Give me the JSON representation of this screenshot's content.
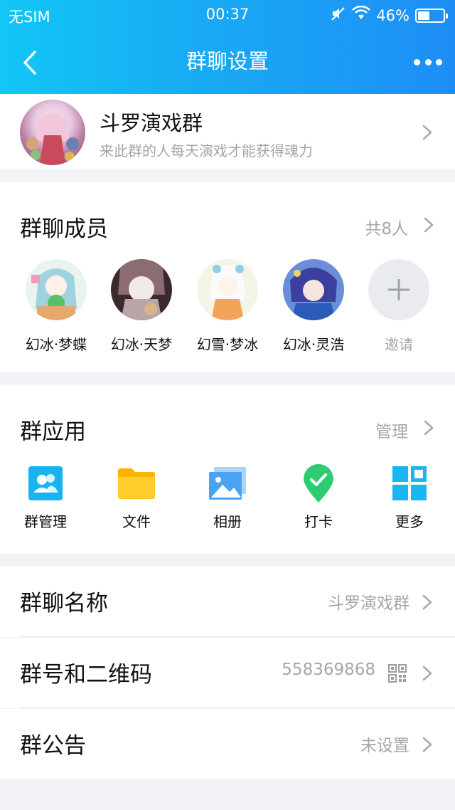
{
  "status_bar": {
    "carrier": "无SIM",
    "time": "00:37",
    "battery": "46%",
    "battery_level": 0.46
  },
  "nav": {
    "title": "群聊设置",
    "back_icon": "chevron-left-icon",
    "more_icon": "more-dots-icon"
  },
  "group": {
    "name": "斗罗演戏群",
    "description": "来此群的人每天演戏才能获得魂力"
  },
  "members": {
    "title": "群聊成员",
    "count": "共8人",
    "list": [
      {
        "name": "幻冰·梦蝶"
      },
      {
        "name": "幻冰·天梦"
      },
      {
        "name": "幻雪·梦冰"
      },
      {
        "name": "幻冰·灵浩"
      }
    ],
    "invite_label": "邀请"
  },
  "apps": {
    "title": "群应用",
    "manage": "管理",
    "items": [
      {
        "label": "群管理",
        "icon": "group-manage-icon",
        "color": "#18b4f0"
      },
      {
        "label": "文件",
        "icon": "folder-icon",
        "color": "#ffc21a"
      },
      {
        "label": "相册",
        "icon": "photo-album-icon",
        "color": "#4aa3f2"
      },
      {
        "label": "打卡",
        "icon": "check-in-icon",
        "color": "#2ecc71"
      },
      {
        "label": "更多",
        "icon": "more-grid-icon",
        "color": "#19b6ef"
      }
    ]
  },
  "settings": {
    "group_name_label": "群聊名称",
    "group_name_value": "斗罗演戏群",
    "group_id_label": "群号和二维码",
    "group_id_value": "558369868",
    "notice_label": "群公告",
    "notice_value": "未设置"
  }
}
